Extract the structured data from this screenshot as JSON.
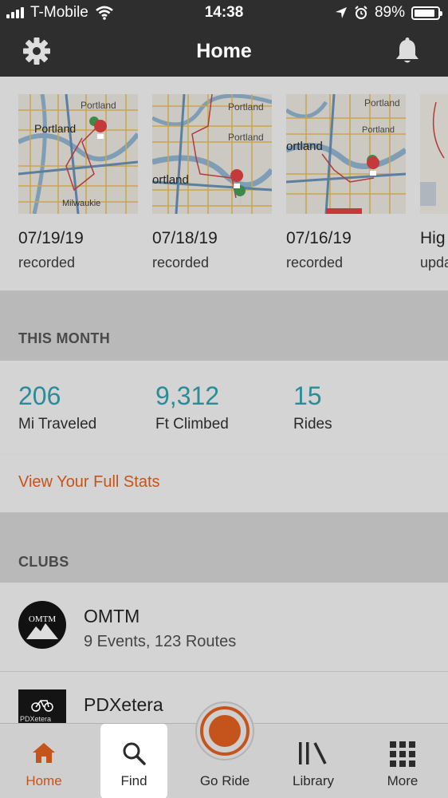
{
  "status_bar": {
    "carrier": "T-Mobile",
    "time": "14:38",
    "battery": "89%",
    "battery_level": 0.89
  },
  "header": {
    "title": "Home",
    "left_icon": "gear-icon",
    "right_icon": "bell-icon"
  },
  "recent_rides": [
    {
      "date": "07/19/19",
      "status": "recorded",
      "map_labels": [
        "Portland",
        "Portland",
        "Milwaukie"
      ]
    },
    {
      "date": "07/18/19",
      "status": "recorded",
      "map_labels": [
        "Portland",
        "Portland",
        "ortland"
      ]
    },
    {
      "date": "07/16/19",
      "status": "recorded",
      "map_labels": [
        "Portland",
        "Portland",
        "ortland"
      ]
    },
    {
      "date": "Hig",
      "status": "upda"
    }
  ],
  "this_month": {
    "header": "THIS MONTH",
    "stats": [
      {
        "value": "206",
        "label": "Mi Traveled"
      },
      {
        "value": "9,312",
        "label": "Ft Climbed"
      },
      {
        "value": "15",
        "label": "Rides"
      }
    ],
    "full_stats_link": "View Your Full Stats"
  },
  "clubs": {
    "header": "CLUBS",
    "items": [
      {
        "name": "OMTM",
        "meta": "9 Events, 123 Routes",
        "logo_text": "OMTM"
      },
      {
        "name": "PDXetera",
        "meta": "",
        "logo_text": "PDXetera"
      }
    ]
  },
  "tab_bar": {
    "tabs": [
      {
        "label": "Home",
        "icon": "home-icon",
        "active": true
      },
      {
        "label": "Find",
        "icon": "search-icon",
        "active": false
      },
      {
        "label": "Go Ride",
        "icon": "record-icon",
        "active": false
      },
      {
        "label": "Library",
        "icon": "library-icon",
        "active": false
      },
      {
        "label": "More",
        "icon": "grid-icon",
        "active": false
      }
    ]
  },
  "colors": {
    "accent_orange": "#c5541c",
    "stat_teal": "#2b8b96",
    "header_dark": "#2e2e2e"
  }
}
